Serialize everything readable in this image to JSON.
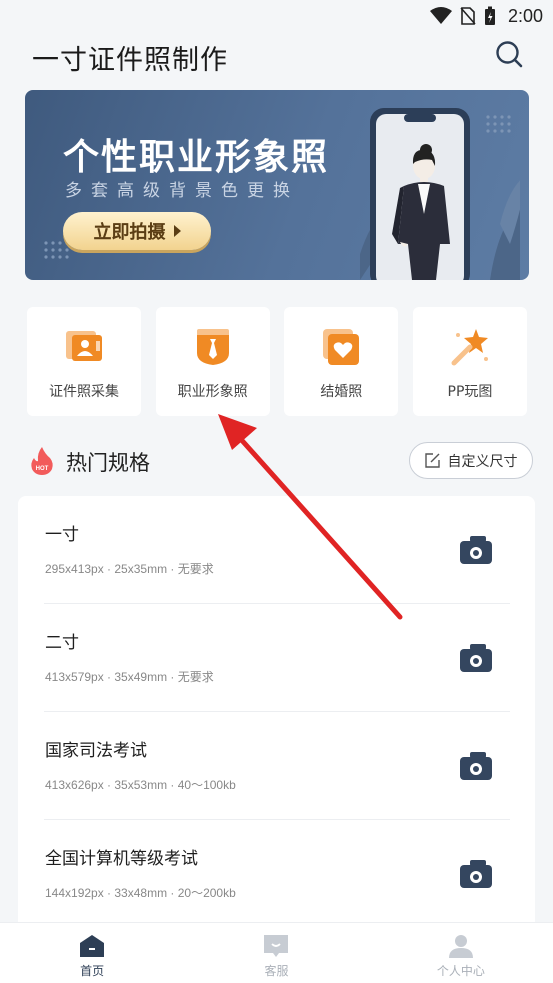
{
  "status_bar": {
    "time": "2:00"
  },
  "header": {
    "title": "一寸证件照制作"
  },
  "banner": {
    "title": "个性职业形象照",
    "subtitle": "多套高级背景色更换",
    "button_label": "立即拍摄"
  },
  "categories": [
    {
      "label": "证件照采集",
      "icon": "id-card-icon"
    },
    {
      "label": "职业形象照",
      "icon": "tie-icon"
    },
    {
      "label": "结婚照",
      "icon": "heart-photo-icon"
    },
    {
      "label": "PP玩图",
      "icon": "magic-wand-icon"
    }
  ],
  "hot_section": {
    "badge": "HOT",
    "title": "热门规格",
    "custom_button": "自定义尺寸"
  },
  "specs": [
    {
      "name": "一寸",
      "detail": "295x413px · 25x35mm · 无要求"
    },
    {
      "name": "二寸",
      "detail": "413x579px · 35x49mm · 无要求"
    },
    {
      "name": "国家司法考试",
      "detail": "413x626px · 35x53mm · 40～100kb"
    },
    {
      "name": "全国计算机等级考试",
      "detail": "144x192px · 33x48mm · 20～200kb"
    }
  ],
  "bottom_nav": [
    {
      "label": "首页",
      "icon": "home-icon",
      "active": true
    },
    {
      "label": "客服",
      "icon": "chat-icon",
      "active": false
    },
    {
      "label": "个人中心",
      "icon": "user-icon",
      "active": false
    }
  ],
  "colors": {
    "accent": "#f08a24",
    "navy": "#34465f",
    "arrow": "#e02424"
  }
}
